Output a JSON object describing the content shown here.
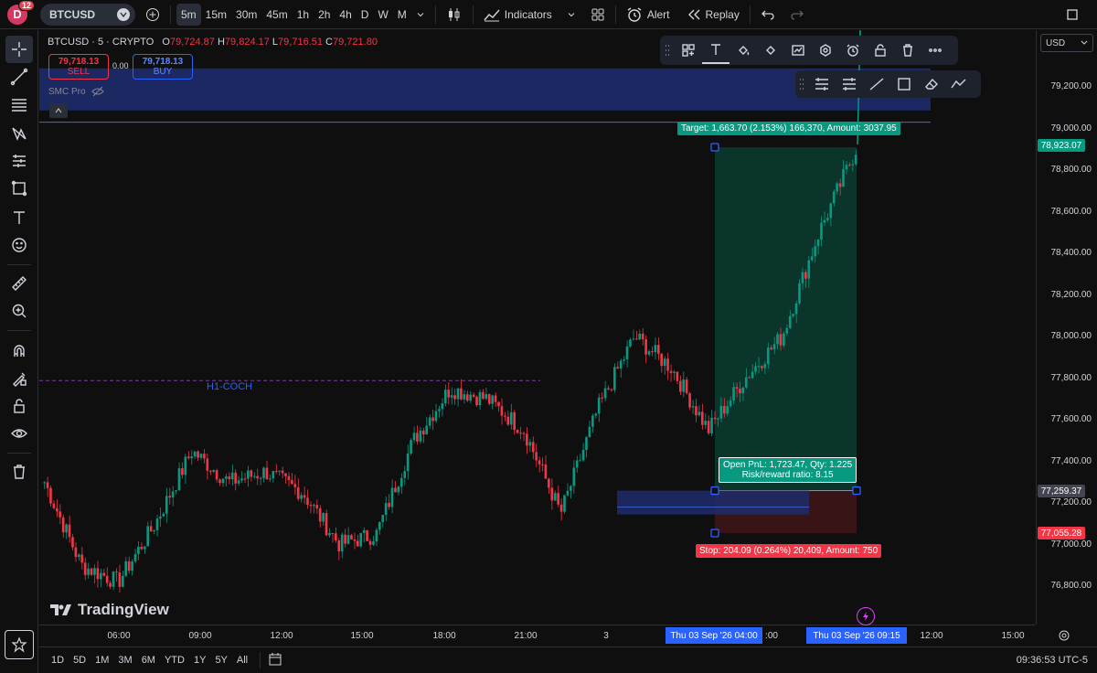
{
  "topbar": {
    "avatar_letter": "D",
    "notifications": "12",
    "symbol": "BTCUSD",
    "intervals": [
      "5m",
      "15m",
      "30m",
      "45m",
      "1h",
      "2h",
      "4h",
      "D",
      "W",
      "M"
    ],
    "active_interval": "5m",
    "indicators_label": "Indicators",
    "alert_label": "Alert",
    "replay_label": "Replay"
  },
  "legend": {
    "title": "BTCUSD · 5 · CRYPTO",
    "open_label": "O",
    "open": "79,724.87",
    "high_label": "H",
    "high": "79,824.17",
    "low_label": "L",
    "low": "79,716.51",
    "close_label": "C",
    "close": "79,721.80",
    "sell_price": "79,718.13",
    "sell_label": "SELL",
    "spread": "0.00",
    "buy_price": "79,718.13",
    "buy_label": "BUY",
    "indicator": "SMC Pro"
  },
  "currency": "USD",
  "price_axis": {
    "ticks": [
      "79,200.00",
      "79,000.00",
      "78,800.00",
      "78,600.00",
      "78,400.00",
      "78,200.00",
      "78,000.00",
      "77,800.00",
      "77,600.00",
      "77,400.00",
      "77,200.00",
      "77,000.00",
      "76,800.00"
    ],
    "tick_values": [
      79200,
      79000,
      78800,
      78600,
      78400,
      78200,
      78000,
      77800,
      77600,
      77400,
      77200,
      77000,
      76800
    ],
    "current_price": "78,923.07",
    "entry_price": "77,259.37",
    "stop_price": "77,055.28"
  },
  "time_axis": {
    "ticks": [
      "06:00",
      "09:00",
      "12:00",
      "15:00",
      "18:00",
      "21:00",
      "3",
      "12:00",
      "15:00"
    ],
    "start_tag": "Thu 03 Sep '26   04:00",
    "end_tag": "Thu 03 Sep '26   09:15",
    "hidden_partial": ":00",
    "clock": "09:36:53 UTC-5"
  },
  "annotations": {
    "h1_coch": "H1-COCH",
    "target": "Target: 1,663.70 (2.153%) 166,370, Amount: 3037.95",
    "open_pnl": "Open PnL: 1,723.47, Qty: 1.225",
    "risk_reward": "Risk/reward ratio: 8.15",
    "stop": "Stop: 204.09 (0.264%) 20,409, Amount: 750"
  },
  "bottombar": {
    "ranges": [
      "1D",
      "5D",
      "1M",
      "3M",
      "6M",
      "YTD",
      "1Y",
      "5Y",
      "All"
    ]
  },
  "watermark": "TradingView",
  "colors": {
    "up": "#089981",
    "down": "#f23645",
    "zone": "#1e2b6b",
    "accent": "#2962ff"
  },
  "chart_data": {
    "type": "candlestick",
    "title": "BTCUSD · 5 · CRYPTO",
    "ylim": [
      76700,
      79350
    ],
    "key_points": [
      {
        "x": "03:00",
        "y": 77300
      },
      {
        "x": "05:00",
        "y": 76900
      },
      {
        "x": "07:00",
        "y": 76820
      },
      {
        "x": "09:00",
        "y": 77100
      },
      {
        "x": "10:00",
        "y": 77450
      },
      {
        "x": "12:00",
        "y": 77300
      },
      {
        "x": "13:00",
        "y": 77350
      },
      {
        "x": "15:00",
        "y": 77250
      },
      {
        "x": "17:00",
        "y": 77000
      },
      {
        "x": "19:30",
        "y": 77050
      },
      {
        "x": "21:00",
        "y": 77500
      },
      {
        "x": "22:00",
        "y": 77750
      },
      {
        "x": "23:00",
        "y": 77700
      },
      {
        "x": "00:00",
        "y": 77550
      },
      {
        "x": "01:00",
        "y": 77150
      },
      {
        "x": "02:00",
        "y": 77650
      },
      {
        "x": "03:00",
        "y": 78000
      },
      {
        "x": "04:00",
        "y": 77850
      },
      {
        "x": "05:00",
        "y": 77550
      },
      {
        "x": "06:00",
        "y": 77800
      },
      {
        "x": "07:00",
        "y": 78000
      },
      {
        "x": "08:00",
        "y": 78500
      },
      {
        "x": "09:00",
        "y": 78900
      }
    ]
  }
}
